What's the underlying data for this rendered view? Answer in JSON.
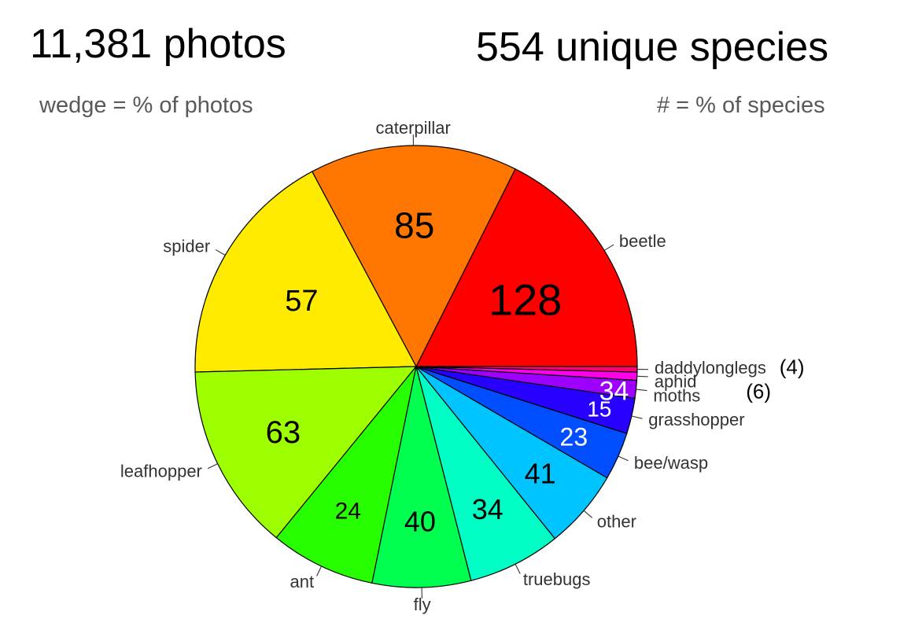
{
  "header": {
    "photos_count": "11,381 photos",
    "species_count": "554 unique species",
    "wedge_note": "wedge = % of photos",
    "number_note": "# = % of species"
  },
  "chart_data": {
    "type": "pie",
    "title": "",
    "start_angle_deg": 0,
    "direction": "counterclockwise",
    "slices": [
      {
        "label": "beetle",
        "percent_photos": 17.6,
        "species_label": "128",
        "color": "#FF0000",
        "label_color": "#000000"
      },
      {
        "label": "caterpillar",
        "percent_photos": 15.2,
        "species_label": "85",
        "color": "#FF7600",
        "label_color": "#000000"
      },
      {
        "label": "spider",
        "percent_photos": 17.6,
        "species_label": "57",
        "color": "#FFEB00",
        "label_color": "#000000"
      },
      {
        "label": "leafhopper",
        "percent_photos": 13.7,
        "species_label": "63",
        "color": "#9DFF00",
        "label_color": "#000000"
      },
      {
        "label": "ant",
        "percent_photos": 7.7,
        "species_label": "24",
        "color": "#27FF00",
        "label_color": "#000000"
      },
      {
        "label": "fly",
        "percent_photos": 7.2,
        "species_label": "40",
        "color": "#00FF4E",
        "label_color": "#000000"
      },
      {
        "label": "truebugs",
        "percent_photos": 6.8,
        "species_label": "34",
        "color": "#00FFC4",
        "label_color": "#000000"
      },
      {
        "label": "other",
        "percent_photos": 5.8,
        "species_label": "41",
        "color": "#00C4FF",
        "label_color": "#000000"
      },
      {
        "label": "bee/wasp",
        "percent_photos": 3.5,
        "species_label": "23",
        "color": "#004EFF",
        "label_color": "#FFFFFF"
      },
      {
        "label": "grasshopper",
        "percent_photos": 2.6,
        "species_label": "15",
        "color": "#2700FF",
        "label_color": "#FFFFFF"
      },
      {
        "label": "moths",
        "percent_photos": 1.3,
        "species_label": "34",
        "color": "#9D00FF",
        "label_color": "#FFFFFF"
      },
      {
        "label": "aphid",
        "percent_photos": 0.6,
        "species_label": "(6)",
        "color": "#FF00EB",
        "label_color": "#000000"
      },
      {
        "label": "daddylonglegs",
        "percent_photos": 0.4,
        "species_label": "(4)",
        "color": "#FF0076",
        "label_color": "#000000"
      }
    ]
  }
}
